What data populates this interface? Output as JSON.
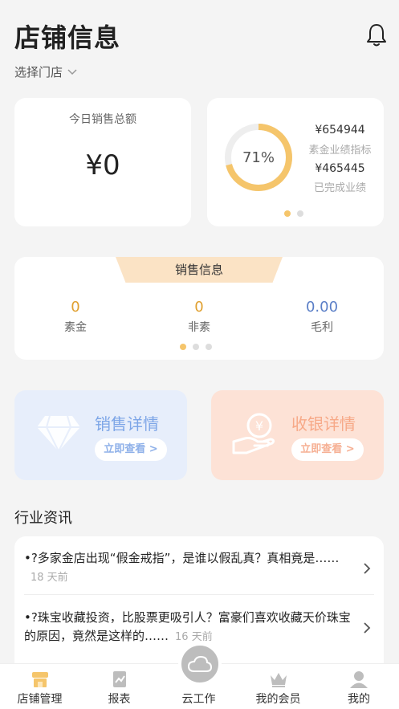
{
  "header": {
    "title": "店铺信息",
    "store_selector": "选择门店"
  },
  "today": {
    "label": "今日销售总额",
    "amount": "¥0"
  },
  "target": {
    "percent_label": "71%",
    "percent": 71,
    "target_value": "¥654944",
    "target_label": "素金业绩指标",
    "done_value": "¥465445",
    "done_label": "已完成业绩",
    "pager": {
      "count": 2,
      "active": 0
    }
  },
  "sales_info": {
    "title": "销售信息",
    "stats": [
      {
        "value": "0",
        "label": "素金",
        "color": "#e0a030"
      },
      {
        "value": "0",
        "label": "非素",
        "color": "#e0a030"
      },
      {
        "value": "0.00",
        "label": "毛利",
        "color": "#5b7fc7"
      }
    ],
    "pager": {
      "count": 3,
      "active": 0
    }
  },
  "promos": {
    "sales": {
      "title": "销售详情",
      "button": "立即查看 >"
    },
    "cash": {
      "title": "收银详情",
      "button": "立即查看 >"
    }
  },
  "news": {
    "title": "行业资讯",
    "items": [
      {
        "text": "•?多家金店出现“假金戒指”，是谁以假乱真？真相竟是……",
        "time": "18 天前"
      },
      {
        "text": "•?珠宝收藏投资，比股票更吸引人？富豪们喜欢收藏天价珠宝的原因，竟然是这样的……",
        "time": "16 天前"
      }
    ]
  },
  "tabbar": {
    "items": [
      {
        "label": "店铺管理",
        "icon": "store-icon",
        "active": true
      },
      {
        "label": "报表",
        "icon": "report-icon"
      },
      {
        "label": "云工作",
        "icon": "cloud-icon"
      },
      {
        "label": "我的会员",
        "icon": "crown-icon"
      },
      {
        "label": "我的",
        "icon": "user-icon"
      }
    ]
  },
  "colors": {
    "accent": "#f5c56b",
    "ring_track": "#eeeeee",
    "sales_blue": "#7ea6e7",
    "cash_orange": "#f7a988"
  }
}
